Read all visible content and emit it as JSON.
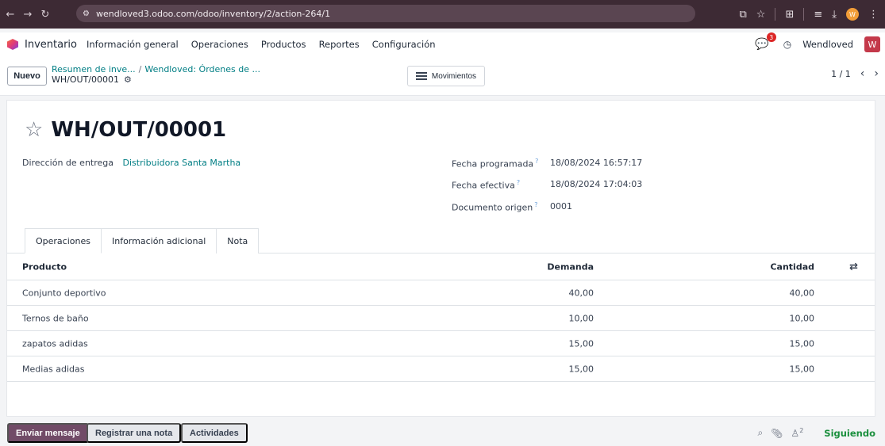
{
  "browser": {
    "url": "wendloved3.odoo.com/odoo/inventory/2/action-264/1",
    "profile_initial": "W"
  },
  "navbar": {
    "app_name": "Inventario",
    "menu": [
      "Información general",
      "Operaciones",
      "Productos",
      "Reportes",
      "Configuración"
    ],
    "chat_badge": "3",
    "company": "Wendloved",
    "avatar_initial": "W"
  },
  "control": {
    "new_label": "Nuevo",
    "breadcrumb": [
      "Resumen de inve...",
      "Wendloved: Órdenes de ..."
    ],
    "current_record": "WH/OUT/00001",
    "moves_label": "Movimientos",
    "pager": "1 / 1"
  },
  "form": {
    "title": "WH/OUT/00001",
    "delivery_label": "Dirección de entrega",
    "delivery_value": "Distribuidora Santa Martha",
    "scheduled_label": "Fecha programada",
    "scheduled_value": "18/08/2024 16:57:17",
    "effective_label": "Fecha efectiva",
    "effective_value": "18/08/2024 17:04:03",
    "origin_label": "Documento origen",
    "origin_value": "0001",
    "help_mark": "?"
  },
  "tabs": [
    "Operaciones",
    "Información adicional",
    "Nota"
  ],
  "table": {
    "headers": {
      "product": "Producto",
      "demand": "Demanda",
      "quantity": "Cantidad"
    },
    "rows": [
      {
        "product": "Conjunto deportivo",
        "demand": "40,00",
        "quantity": "40,00"
      },
      {
        "product": "Ternos de baño",
        "demand": "10,00",
        "quantity": "10,00"
      },
      {
        "product": "zapatos adidas",
        "demand": "15,00",
        "quantity": "15,00"
      },
      {
        "product": "Medias adidas",
        "demand": "15,00",
        "quantity": "15,00"
      }
    ]
  },
  "chatter": {
    "send_message": "Enviar mensaje",
    "log_note": "Registrar una nota",
    "activities": "Actividades",
    "followers_count": "2",
    "following": "Siguiendo"
  },
  "colors": {
    "browser_bar": "#3d2a34",
    "odoo_primary": "#714b67",
    "link_teal": "#017e84",
    "following_green": "#1a8f3d",
    "badge_red": "#dc2626"
  }
}
